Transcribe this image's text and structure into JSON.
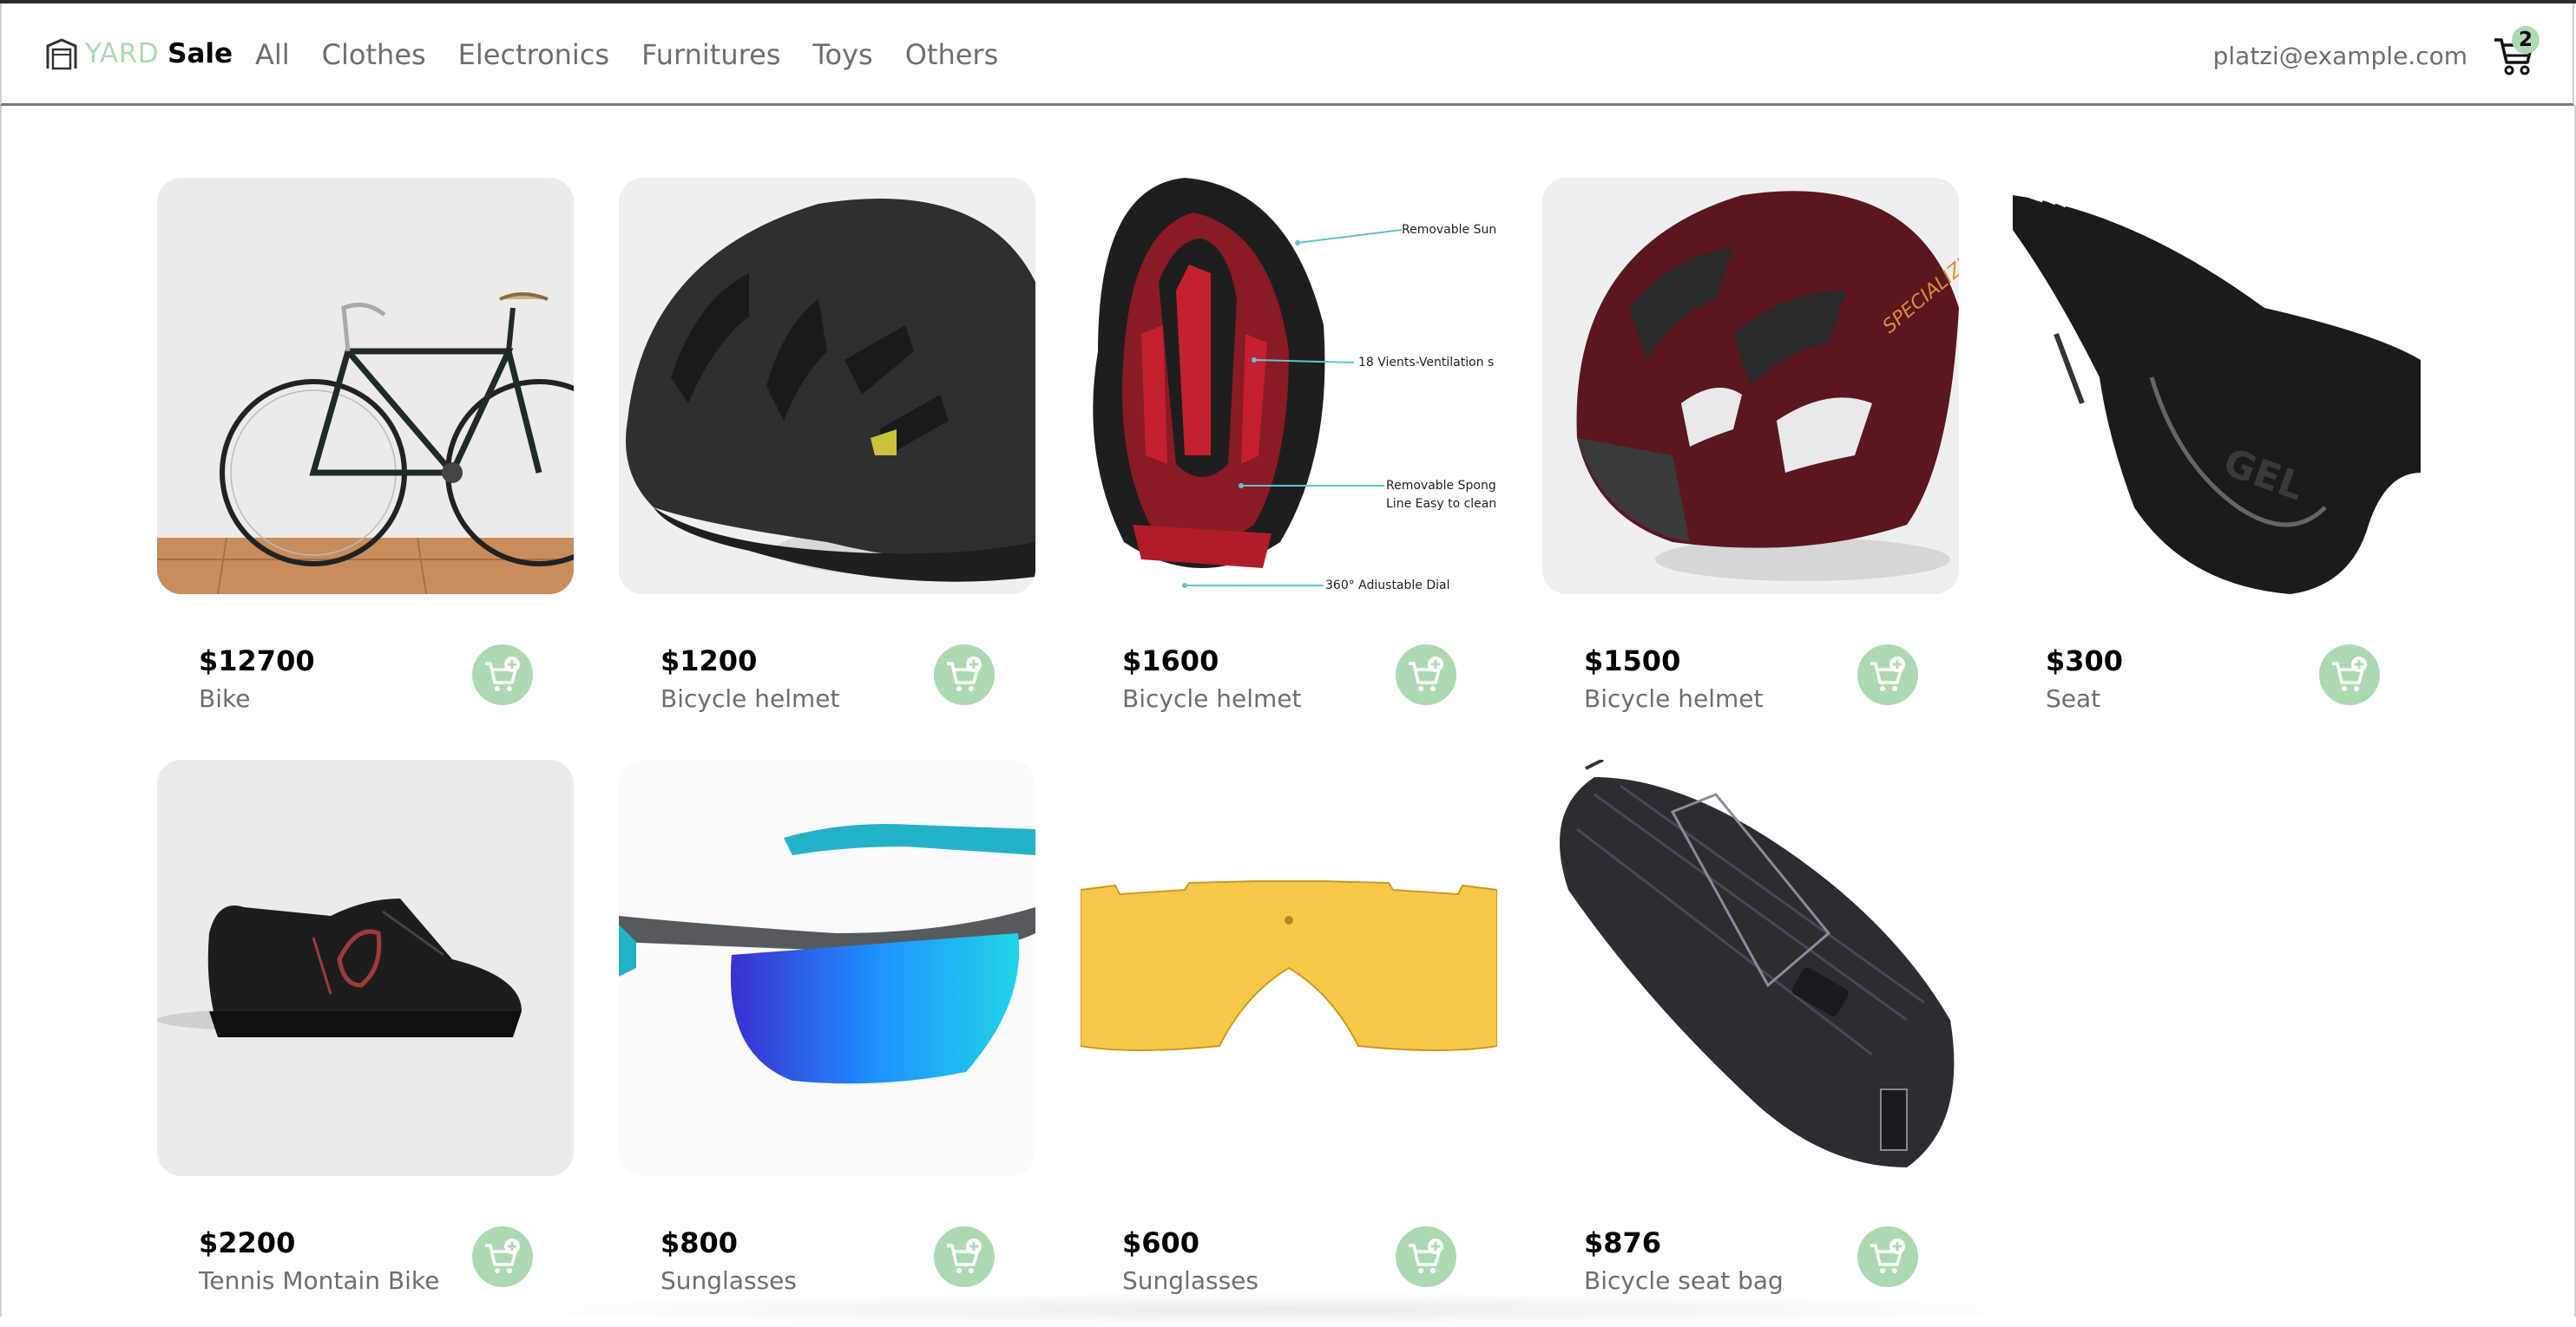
{
  "brand": {
    "yard": "YARD",
    "sale": "Sale"
  },
  "nav": [
    "All",
    "Clothes",
    "Electronics",
    "Furnitures",
    "Toys",
    "Others"
  ],
  "user": {
    "email": "platzi@example.com"
  },
  "cart": {
    "count": "2"
  },
  "accent_color": "#acd9b2",
  "products": [
    {
      "price": "$12700",
      "name": "Bike"
    },
    {
      "price": "$1200",
      "name": "Bicycle helmet"
    },
    {
      "price": "$1600",
      "name": "Bicycle helmet",
      "callouts": [
        "Removable Sun",
        "18 Vients-Ventilation s",
        "Removable Spong",
        "Line Easy to clean",
        "360° Adiustable Dial"
      ]
    },
    {
      "price": "$1500",
      "name": "Bicycle helmet",
      "image_text": "SPECIALIZED"
    },
    {
      "price": "$300",
      "name": "Seat",
      "image_text": "GEL"
    },
    {
      "price": "$2200",
      "name": "Tennis Montain Bike"
    },
    {
      "price": "$800",
      "name": "Sunglasses"
    },
    {
      "price": "$600",
      "name": "Sunglasses"
    },
    {
      "price": "$876",
      "name": "Bicycle seat bag"
    }
  ]
}
